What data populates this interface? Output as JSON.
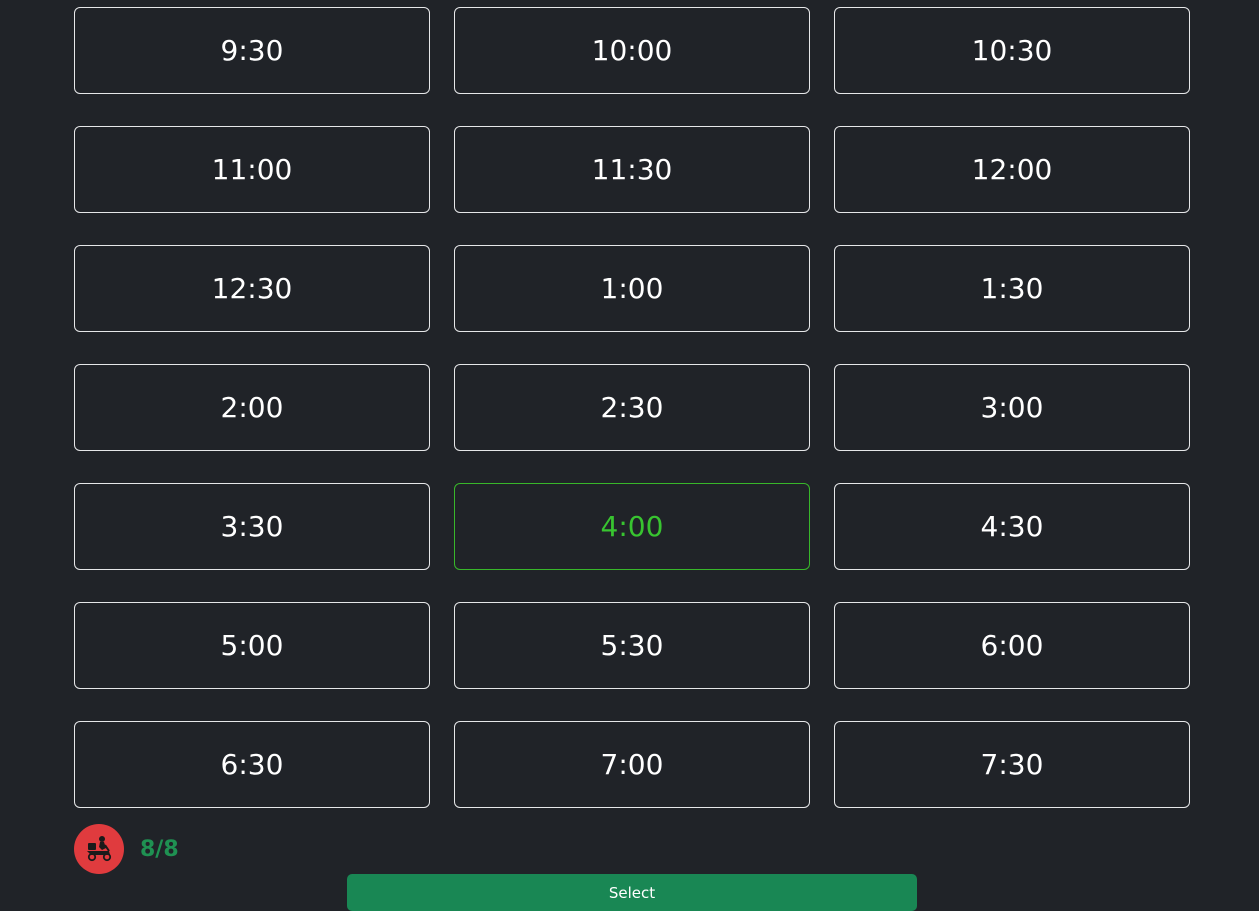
{
  "time_slots": [
    {
      "label": "9:30",
      "selected": false
    },
    {
      "label": "10:00",
      "selected": false
    },
    {
      "label": "10:30",
      "selected": false
    },
    {
      "label": "11:00",
      "selected": false
    },
    {
      "label": "11:30",
      "selected": false
    },
    {
      "label": "12:00",
      "selected": false
    },
    {
      "label": "12:30",
      "selected": false
    },
    {
      "label": "1:00",
      "selected": false
    },
    {
      "label": "1:30",
      "selected": false
    },
    {
      "label": "2:00",
      "selected": false
    },
    {
      "label": "2:30",
      "selected": false
    },
    {
      "label": "3:00",
      "selected": false
    },
    {
      "label": "3:30",
      "selected": false
    },
    {
      "label": "4:00",
      "selected": true
    },
    {
      "label": "4:30",
      "selected": false
    },
    {
      "label": "5:00",
      "selected": false
    },
    {
      "label": "5:30",
      "selected": false
    },
    {
      "label": "6:00",
      "selected": false
    },
    {
      "label": "6:30",
      "selected": false
    },
    {
      "label": "7:00",
      "selected": false
    },
    {
      "label": "7:30",
      "selected": false
    }
  ],
  "delivery": {
    "icon": "delivery-scooter-icon",
    "count": "8/8"
  },
  "actions": {
    "select_label": "Select"
  },
  "colors": {
    "background": "#202328",
    "selected_accent": "#38c430",
    "count_text": "#1f9152",
    "avatar_bg": "#e03b3e",
    "button_bg": "#198754"
  }
}
